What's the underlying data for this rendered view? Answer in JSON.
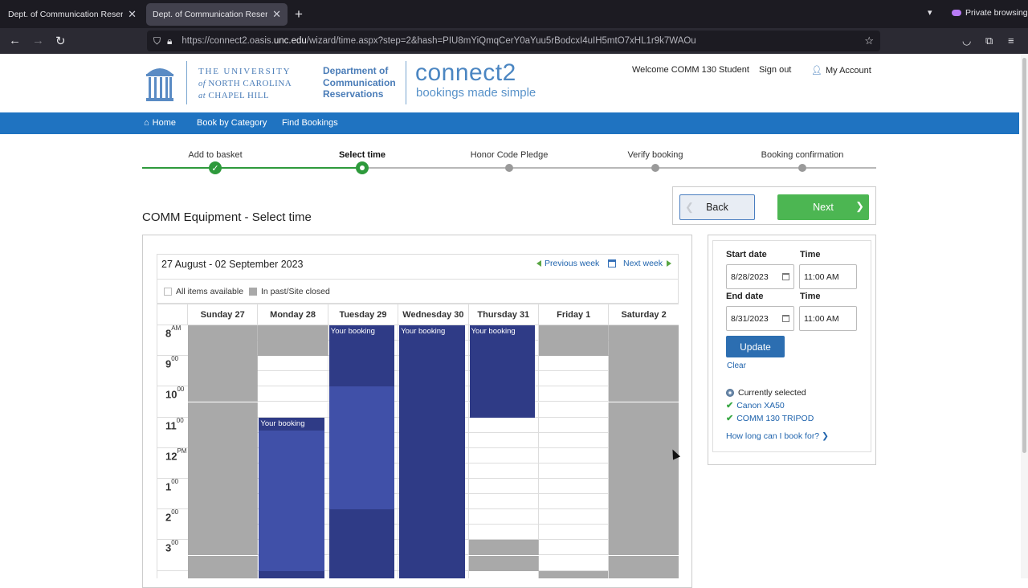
{
  "browser": {
    "tabs": [
      {
        "title": "Dept. of Communication Reservations"
      },
      {
        "title": "Dept. of Communication Reservations"
      }
    ],
    "private_label": "Private browsing",
    "url_prefix": "https://connect2.oasis.",
    "url_domain": "unc.edu",
    "url_suffix": "/wizard/time.aspx?step=2&hash=PIU8mYiQmqCerY0aYuu5rBodcxI4uIH5mtO7xHL1r9k7WAOu"
  },
  "header": {
    "univ_line1": "THE UNIVERSITY",
    "univ_line2_prefix": "of",
    "univ_line2": "NORTH CAROLINA",
    "univ_line3_prefix": "at",
    "univ_line3": "CHAPEL HILL",
    "dept_line1": "Department of",
    "dept_line2": "Communication",
    "dept_line3": "Reservations",
    "brand": "connect2",
    "tagline": "bookings made simple",
    "welcome": "Welcome COMM 130 Student",
    "sign_out": "Sign out",
    "account": "My Account"
  },
  "nav": {
    "home": "Home",
    "book_by_category": "Book by Category",
    "find_bookings": "Find Bookings"
  },
  "steps": [
    {
      "label": "Add to basket"
    },
    {
      "label": "Select time"
    },
    {
      "label": "Honor Code Pledge"
    },
    {
      "label": "Verify booking"
    },
    {
      "label": "Booking confirmation"
    }
  ],
  "buttons": {
    "back": "Back",
    "next": "Next"
  },
  "page_title": "COMM Equipment - Select time",
  "calendar": {
    "week_range": "27 August - 02 September 2023",
    "prev_week": "Previous week",
    "next_week": "Next week",
    "legend_available": "All items available",
    "legend_closed": "In past/Site closed",
    "days": [
      "Sunday 27",
      "Monday 28",
      "Tuesday 29",
      "Wednesday 30",
      "Thursday 31",
      "Friday 1",
      "Saturday 2"
    ],
    "hours": [
      {
        "num": "8",
        "suffix": "AM"
      },
      {
        "num": "9",
        "suffix": "00"
      },
      {
        "num": "10",
        "suffix": "00"
      },
      {
        "num": "11",
        "suffix": "00"
      },
      {
        "num": "12",
        "suffix": "PM"
      },
      {
        "num": "1",
        "suffix": "00"
      },
      {
        "num": "2",
        "suffix": "00"
      },
      {
        "num": "3",
        "suffix": "00"
      }
    ],
    "booking_label": "Your booking"
  },
  "side": {
    "start_date_label": "Start date",
    "start_date": "8/28/2023",
    "start_time_label": "Time",
    "start_time": "11:00 AM",
    "end_date_label": "End date",
    "end_date": "8/31/2023",
    "end_time_label": "Time",
    "end_time": "11:00 AM",
    "update": "Update",
    "clear": "Clear",
    "currently_selected": "Currently selected",
    "items": [
      "Canon XA50",
      "COMM 130 TRIPOD"
    ],
    "how_long": "How long can I book for?"
  },
  "colors": {
    "nav_blue": "#1f73c1",
    "booking_navy": "#2f3b86",
    "closed_gray": "#a9a9a9",
    "next_green": "#4cb652",
    "progress_green": "#2e9a3c"
  }
}
